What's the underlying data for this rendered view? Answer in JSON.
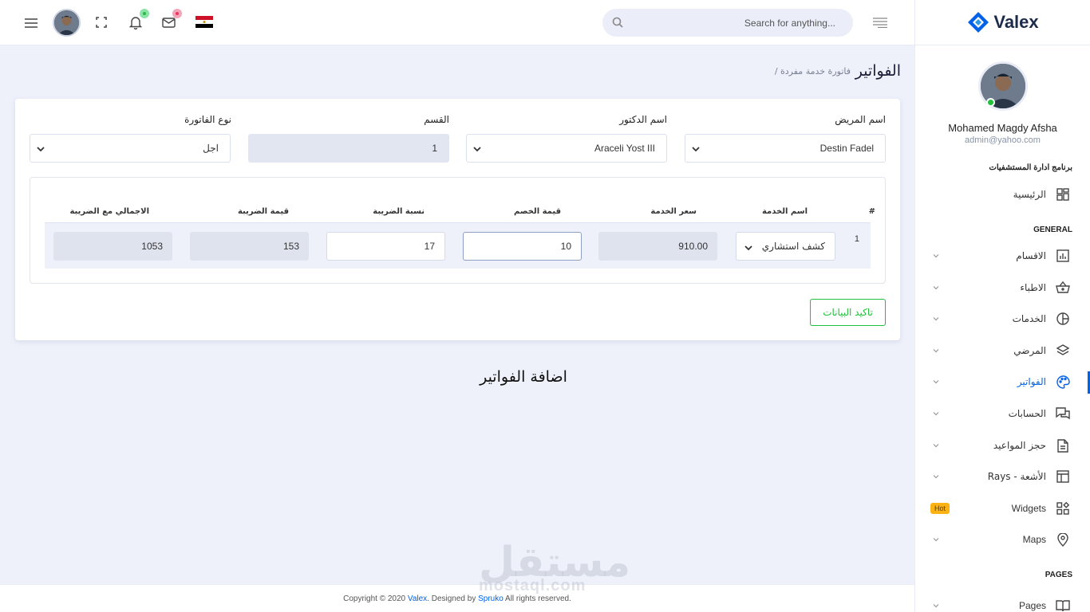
{
  "header": {
    "search_placeholder": "Search for anything..."
  },
  "sidebar": {
    "brand": "Valex",
    "user_name": "Mohamed Magdy Afsha",
    "user_email": "admin@yahoo.com",
    "section_main": "برنامج ادارة المستشفيات",
    "section_general": "GENERAL",
    "section_pages": "PAGES",
    "items": [
      {
        "label": "الرئيسية",
        "icon": "dashboard-icon"
      },
      {
        "label": "الاقسام",
        "icon": "bar-chart-icon"
      },
      {
        "label": "الاطباء",
        "icon": "basket-icon"
      },
      {
        "label": "الخدمات",
        "icon": "pie-chart-icon"
      },
      {
        "label": "المرضي",
        "icon": "layers-icon"
      },
      {
        "label": "الفواتير",
        "icon": "palette-icon"
      },
      {
        "label": "الحسابات",
        "icon": "chat-icon"
      },
      {
        "label": "حجز المواعيد",
        "icon": "document-icon"
      },
      {
        "label": "Rays - الأشعة",
        "icon": "table-icon"
      },
      {
        "label": "Widgets",
        "icon": "widgets-icon",
        "badge": "Hot"
      },
      {
        "label": "Maps",
        "icon": "map-pin-icon"
      },
      {
        "label": "Pages",
        "icon": "book-icon"
      }
    ]
  },
  "page": {
    "title": "الفواتير",
    "breadcrumb": "/ فاتورة خدمة مفردة"
  },
  "form": {
    "patient_label": "اسم المريض",
    "patient_value": "Destin Fadel",
    "doctor_label": "اسم الدكتور",
    "doctor_value": "Araceli Yost III",
    "section_label": "القسم",
    "section_value": "1",
    "invoice_type_label": "نوع الفاتورة",
    "invoice_type_value": "اجل"
  },
  "table": {
    "headers": {
      "num": "#",
      "service_name": "اسم الخدمة",
      "service_price": "سعر الخدمة",
      "discount": "قيمة الخصم",
      "tax_rate": "نسبة الضريبة",
      "tax_value": "قيمة الضريبة",
      "total": "الاجمالي مع الضريبة"
    },
    "row": {
      "num": "1",
      "service_name": "كشف استشاري",
      "service_price": "910.00",
      "discount": "10",
      "tax_rate": "17",
      "tax_value": "153",
      "total": "1053"
    }
  },
  "submit_label": "تاكيد البيانات",
  "section_title": "اضافة الفواتير",
  "watermark": {
    "ar": "مستقل",
    "en": "mostaql.com"
  },
  "footer": {
    "copyright": "Copyright © 2020",
    "brand": "Valex",
    "designed_by": ". Designed by",
    "designer": "Spruko",
    "rights": "All rights reserved."
  },
  "colors": {
    "primary": "#0162e8",
    "success": "#22c03c",
    "hot": "#fbb313"
  }
}
